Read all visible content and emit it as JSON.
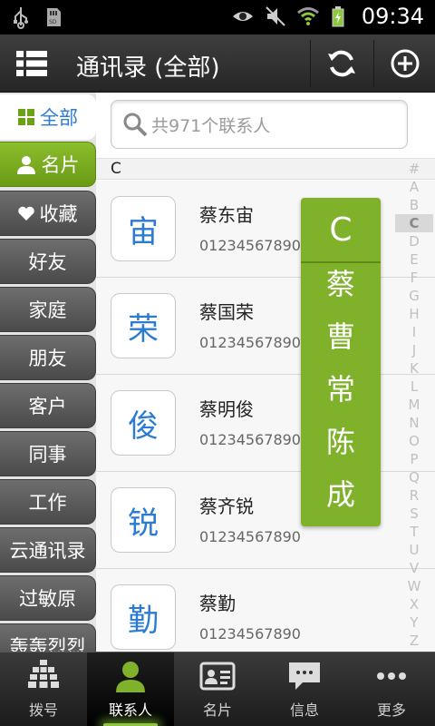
{
  "title": "通讯录 (全部)",
  "status": {
    "time": "09:34"
  },
  "sidebar": {
    "items": [
      {
        "label": "全部"
      },
      {
        "label": "名片"
      },
      {
        "label": "收藏"
      },
      {
        "label": "好友"
      },
      {
        "label": "家庭"
      },
      {
        "label": "朋友"
      },
      {
        "label": "客户"
      },
      {
        "label": "同事"
      },
      {
        "label": "工作"
      },
      {
        "label": "云通讯录"
      },
      {
        "label": "过敏原"
      },
      {
        "label": "轰轰烈烈"
      }
    ]
  },
  "search": {
    "placeholder": "共971个联系人"
  },
  "section": {
    "letter": "C"
  },
  "contacts": [
    {
      "avatar": "宙",
      "name": "蔡东宙",
      "phone": "01234567890"
    },
    {
      "avatar": "荣",
      "name": "蔡国荣",
      "phone": "01234567890"
    },
    {
      "avatar": "俊",
      "name": "蔡明俊",
      "phone": "01234567890"
    },
    {
      "avatar": "锐",
      "name": "蔡齐锐",
      "phone": "01234567890"
    },
    {
      "avatar": "勤",
      "name": "蔡勤",
      "phone": "01234567890"
    }
  ],
  "index": [
    "#",
    "A",
    "B",
    "C",
    "D",
    "E",
    "F",
    "G",
    "H",
    "I",
    "J",
    "K",
    "L",
    "M",
    "N",
    "O",
    "P",
    "Q",
    "R",
    "S",
    "T",
    "U",
    "V",
    "W",
    "X",
    "Y",
    "Z"
  ],
  "overlay": {
    "letter": "C",
    "items": [
      "蔡",
      "曹",
      "常",
      "陈",
      "成"
    ]
  },
  "bottomnav": {
    "tabs": [
      {
        "label": "拨号"
      },
      {
        "label": "联系人"
      },
      {
        "label": "名片"
      },
      {
        "label": "信息"
      },
      {
        "label": "更多"
      }
    ]
  },
  "colors": {
    "accent": "#7fb22a",
    "blue": "#2a7bd4",
    "dark": "#2e2e2e"
  }
}
